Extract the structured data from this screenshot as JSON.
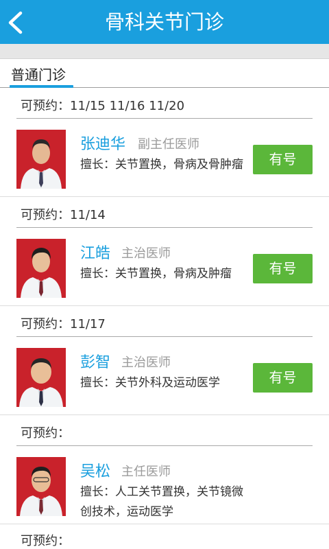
{
  "header": {
    "title": "骨科关节门诊"
  },
  "tab": {
    "label": "普通门诊"
  },
  "doctors": [
    {
      "avail": "可预约：11/15 11/16 11/20",
      "name": "张迪华",
      "title": "副主任医师",
      "skill": "擅长：关节置换，骨病及骨肿瘤",
      "button": "有号"
    },
    {
      "avail": "可预约：11/14",
      "name": "江皓",
      "title": "主治医师",
      "skill": "擅长：关节置换，骨病及肿瘤",
      "button": "有号"
    },
    {
      "avail": "可预约：11/17",
      "name": "彭智",
      "title": "主治医师",
      "skill": "擅长：关节外科及运动医学",
      "button": "有号"
    },
    {
      "avail": "可预约：",
      "name": "吴松",
      "title": "主任医师",
      "skill": "擅长：人工关节置换，关节镜微创技术，运动医学",
      "button": ""
    }
  ],
  "last_avail": "可预约：",
  "colors": {
    "header": "#1a9fde",
    "button": "#5bb73a",
    "photo_bg": "#c9222b",
    "name": "#1a9fde"
  }
}
